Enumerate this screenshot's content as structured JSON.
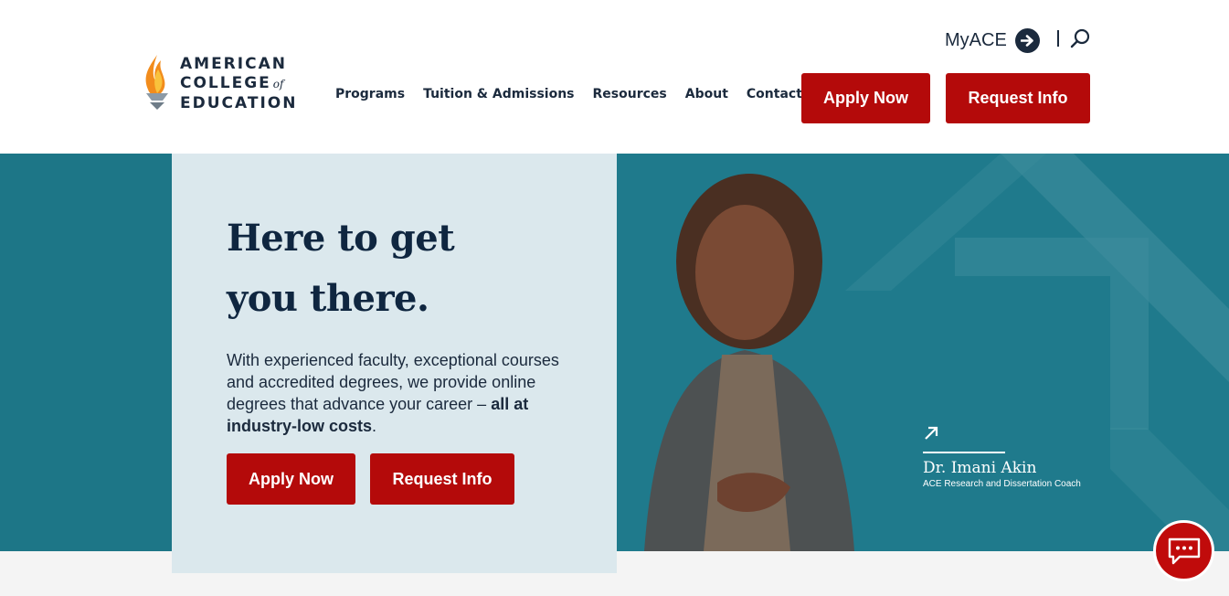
{
  "header": {
    "logo": {
      "line1": "AMERICAN",
      "line2": "COLLEGE",
      "of": "of",
      "line3": "EDUCATION",
      "icon": "torch-flame-icon"
    },
    "nav": [
      {
        "label": "Programs"
      },
      {
        "label": "Tuition & Admissions"
      },
      {
        "label": "Resources"
      },
      {
        "label": "About"
      },
      {
        "label": "Contact"
      }
    ],
    "myace_label": "MyACE",
    "apply_label": "Apply Now",
    "request_label": "Request Info"
  },
  "hero": {
    "headline_line1": "Here to get",
    "headline_line2": "you there.",
    "body": "With experienced faculty, exceptional courses and accredited degrees, we provide online degrees that advance your career –",
    "body_bold": "all at industry-low costs",
    "body_end": ".",
    "apply_label": "Apply Now",
    "request_label": "Request Info",
    "caption": {
      "name": "Dr. Imani Akin",
      "title": "ACE Research and Dissertation Coach"
    }
  },
  "colors": {
    "brand_red": "#b40a0a",
    "navy": "#1b2a3d",
    "teal": "#1d7687",
    "card": "#dbe8ed"
  },
  "icons": {
    "myace": "arrow-right-circle-icon",
    "search": "search-icon",
    "chat": "chat-bubble-icon",
    "caption": "arrow-up-right-icon"
  }
}
